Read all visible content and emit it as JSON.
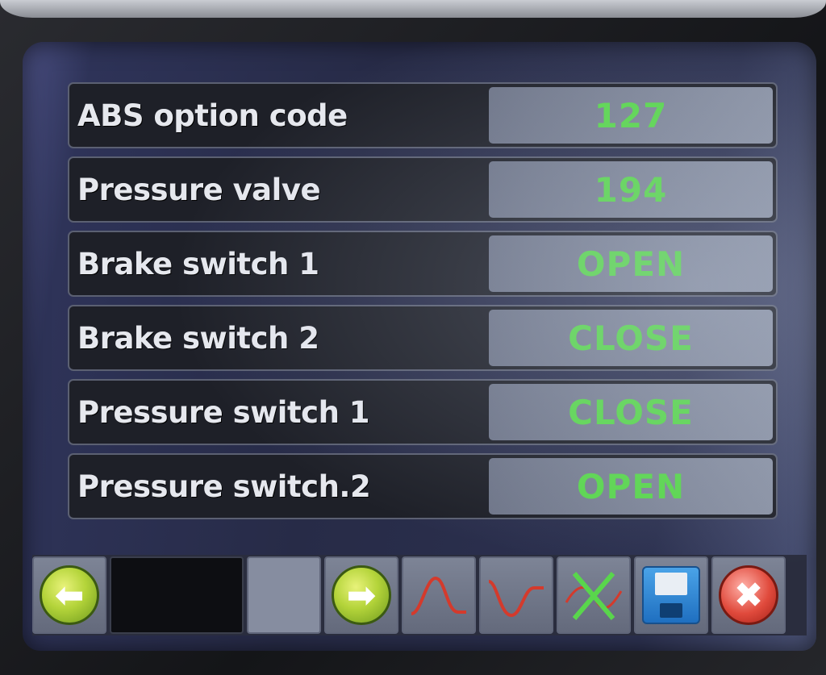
{
  "rows": [
    {
      "label": "ABS option code",
      "value": "127"
    },
    {
      "label": "Pressure valve",
      "value": "194"
    },
    {
      "label": "Brake switch 1",
      "value": "OPEN"
    },
    {
      "label": "Brake switch 2",
      "value": "CLOSE"
    },
    {
      "label": "Pressure switch 1",
      "value": "CLOSE"
    },
    {
      "label": "Pressure switch.2",
      "value": "OPEN"
    }
  ],
  "toolbar": {
    "back_icon": "arrow-left-icon",
    "forward_icon": "arrow-right-icon",
    "graph_rise_icon": "graph-peak-icon",
    "graph_wave_icon": "graph-wave-icon",
    "graph_clear_icon": "graph-clear-icon",
    "save_icon": "floppy-disk-icon",
    "exit_icon": "close-icon",
    "back_glyph": "⬅",
    "forward_glyph": "➡",
    "exit_glyph": "✖"
  },
  "colors": {
    "value_text": "#59d64c",
    "label_text": "#e6e8ee",
    "graph_line": "#d43a2c"
  }
}
